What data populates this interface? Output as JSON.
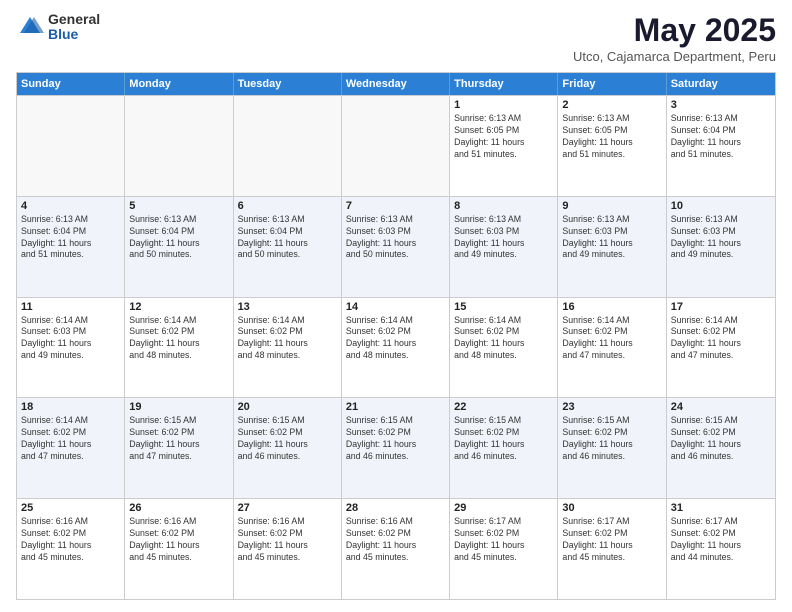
{
  "logo": {
    "general": "General",
    "blue": "Blue"
  },
  "title": "May 2025",
  "subtitle": "Utco, Cajamarca Department, Peru",
  "header": {
    "days": [
      "Sunday",
      "Monday",
      "Tuesday",
      "Wednesday",
      "Thursday",
      "Friday",
      "Saturday"
    ]
  },
  "weeks": [
    {
      "cells": [
        {
          "day": "",
          "info": ""
        },
        {
          "day": "",
          "info": ""
        },
        {
          "day": "",
          "info": ""
        },
        {
          "day": "",
          "info": ""
        },
        {
          "day": "1",
          "info": "Sunrise: 6:13 AM\nSunset: 6:05 PM\nDaylight: 11 hours\nand 51 minutes."
        },
        {
          "day": "2",
          "info": "Sunrise: 6:13 AM\nSunset: 6:05 PM\nDaylight: 11 hours\nand 51 minutes."
        },
        {
          "day": "3",
          "info": "Sunrise: 6:13 AM\nSunset: 6:04 PM\nDaylight: 11 hours\nand 51 minutes."
        }
      ]
    },
    {
      "cells": [
        {
          "day": "4",
          "info": "Sunrise: 6:13 AM\nSunset: 6:04 PM\nDaylight: 11 hours\nand 51 minutes."
        },
        {
          "day": "5",
          "info": "Sunrise: 6:13 AM\nSunset: 6:04 PM\nDaylight: 11 hours\nand 50 minutes."
        },
        {
          "day": "6",
          "info": "Sunrise: 6:13 AM\nSunset: 6:04 PM\nDaylight: 11 hours\nand 50 minutes."
        },
        {
          "day": "7",
          "info": "Sunrise: 6:13 AM\nSunset: 6:03 PM\nDaylight: 11 hours\nand 50 minutes."
        },
        {
          "day": "8",
          "info": "Sunrise: 6:13 AM\nSunset: 6:03 PM\nDaylight: 11 hours\nand 49 minutes."
        },
        {
          "day": "9",
          "info": "Sunrise: 6:13 AM\nSunset: 6:03 PM\nDaylight: 11 hours\nand 49 minutes."
        },
        {
          "day": "10",
          "info": "Sunrise: 6:13 AM\nSunset: 6:03 PM\nDaylight: 11 hours\nand 49 minutes."
        }
      ]
    },
    {
      "cells": [
        {
          "day": "11",
          "info": "Sunrise: 6:14 AM\nSunset: 6:03 PM\nDaylight: 11 hours\nand 49 minutes."
        },
        {
          "day": "12",
          "info": "Sunrise: 6:14 AM\nSunset: 6:02 PM\nDaylight: 11 hours\nand 48 minutes."
        },
        {
          "day": "13",
          "info": "Sunrise: 6:14 AM\nSunset: 6:02 PM\nDaylight: 11 hours\nand 48 minutes."
        },
        {
          "day": "14",
          "info": "Sunrise: 6:14 AM\nSunset: 6:02 PM\nDaylight: 11 hours\nand 48 minutes."
        },
        {
          "day": "15",
          "info": "Sunrise: 6:14 AM\nSunset: 6:02 PM\nDaylight: 11 hours\nand 48 minutes."
        },
        {
          "day": "16",
          "info": "Sunrise: 6:14 AM\nSunset: 6:02 PM\nDaylight: 11 hours\nand 47 minutes."
        },
        {
          "day": "17",
          "info": "Sunrise: 6:14 AM\nSunset: 6:02 PM\nDaylight: 11 hours\nand 47 minutes."
        }
      ]
    },
    {
      "cells": [
        {
          "day": "18",
          "info": "Sunrise: 6:14 AM\nSunset: 6:02 PM\nDaylight: 11 hours\nand 47 minutes."
        },
        {
          "day": "19",
          "info": "Sunrise: 6:15 AM\nSunset: 6:02 PM\nDaylight: 11 hours\nand 47 minutes."
        },
        {
          "day": "20",
          "info": "Sunrise: 6:15 AM\nSunset: 6:02 PM\nDaylight: 11 hours\nand 46 minutes."
        },
        {
          "day": "21",
          "info": "Sunrise: 6:15 AM\nSunset: 6:02 PM\nDaylight: 11 hours\nand 46 minutes."
        },
        {
          "day": "22",
          "info": "Sunrise: 6:15 AM\nSunset: 6:02 PM\nDaylight: 11 hours\nand 46 minutes."
        },
        {
          "day": "23",
          "info": "Sunrise: 6:15 AM\nSunset: 6:02 PM\nDaylight: 11 hours\nand 46 minutes."
        },
        {
          "day": "24",
          "info": "Sunrise: 6:15 AM\nSunset: 6:02 PM\nDaylight: 11 hours\nand 46 minutes."
        }
      ]
    },
    {
      "cells": [
        {
          "day": "25",
          "info": "Sunrise: 6:16 AM\nSunset: 6:02 PM\nDaylight: 11 hours\nand 45 minutes."
        },
        {
          "day": "26",
          "info": "Sunrise: 6:16 AM\nSunset: 6:02 PM\nDaylight: 11 hours\nand 45 minutes."
        },
        {
          "day": "27",
          "info": "Sunrise: 6:16 AM\nSunset: 6:02 PM\nDaylight: 11 hours\nand 45 minutes."
        },
        {
          "day": "28",
          "info": "Sunrise: 6:16 AM\nSunset: 6:02 PM\nDaylight: 11 hours\nand 45 minutes."
        },
        {
          "day": "29",
          "info": "Sunrise: 6:17 AM\nSunset: 6:02 PM\nDaylight: 11 hours\nand 45 minutes."
        },
        {
          "day": "30",
          "info": "Sunrise: 6:17 AM\nSunset: 6:02 PM\nDaylight: 11 hours\nand 45 minutes."
        },
        {
          "day": "31",
          "info": "Sunrise: 6:17 AM\nSunset: 6:02 PM\nDaylight: 11 hours\nand 44 minutes."
        }
      ]
    }
  ]
}
